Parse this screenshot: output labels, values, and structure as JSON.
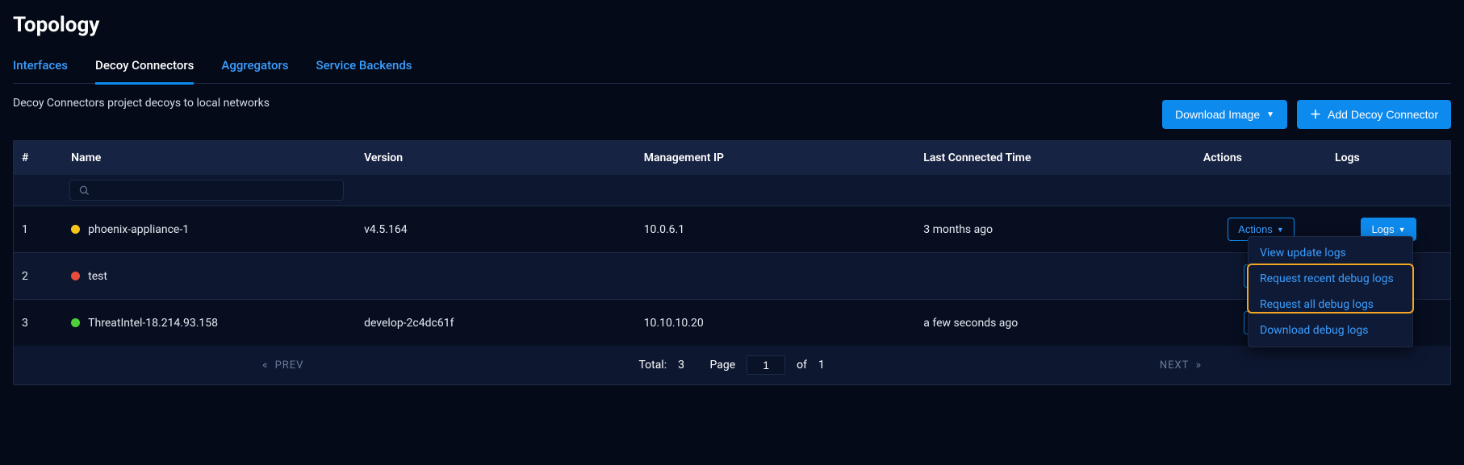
{
  "page_title": "Topology",
  "tabs": [
    {
      "label": "Interfaces",
      "active": false
    },
    {
      "label": "Decoy Connectors",
      "active": true
    },
    {
      "label": "Aggregators",
      "active": false
    },
    {
      "label": "Service Backends",
      "active": false
    }
  ],
  "description": "Decoy Connectors project decoys to local networks",
  "buttons": {
    "download_image": "Download Image",
    "add_connector": "Add Decoy Connector"
  },
  "columns": {
    "num": "#",
    "name": "Name",
    "version": "Version",
    "mgmt_ip": "Management IP",
    "last_connected": "Last Connected Time",
    "actions": "Actions",
    "logs": "Logs"
  },
  "action_button_label": "Actions",
  "logs_button_label": "Logs",
  "rows": [
    {
      "num": "1",
      "status": "yellow",
      "name": "phoenix-appliance-1",
      "version": "v4.5.164",
      "ip": "10.0.6.1",
      "time": "3 months ago"
    },
    {
      "num": "2",
      "status": "red",
      "name": "test",
      "version": "",
      "ip": "",
      "time": ""
    },
    {
      "num": "3",
      "status": "green",
      "name": "ThreatIntel-18.214.93.158",
      "version": "develop-2c4dc61f",
      "ip": "10.10.10.20",
      "time": "a few seconds ago"
    }
  ],
  "pagination": {
    "prev": "PREV",
    "next": "NEXT",
    "total_label": "Total:",
    "total": "3",
    "page_label": "Page",
    "page": "1",
    "of_label": "of",
    "of": "1"
  },
  "logs_menu": {
    "view_update": "View update logs",
    "request_recent": "Request recent debug logs",
    "request_all": "Request all debug logs",
    "download": "Download debug logs"
  }
}
